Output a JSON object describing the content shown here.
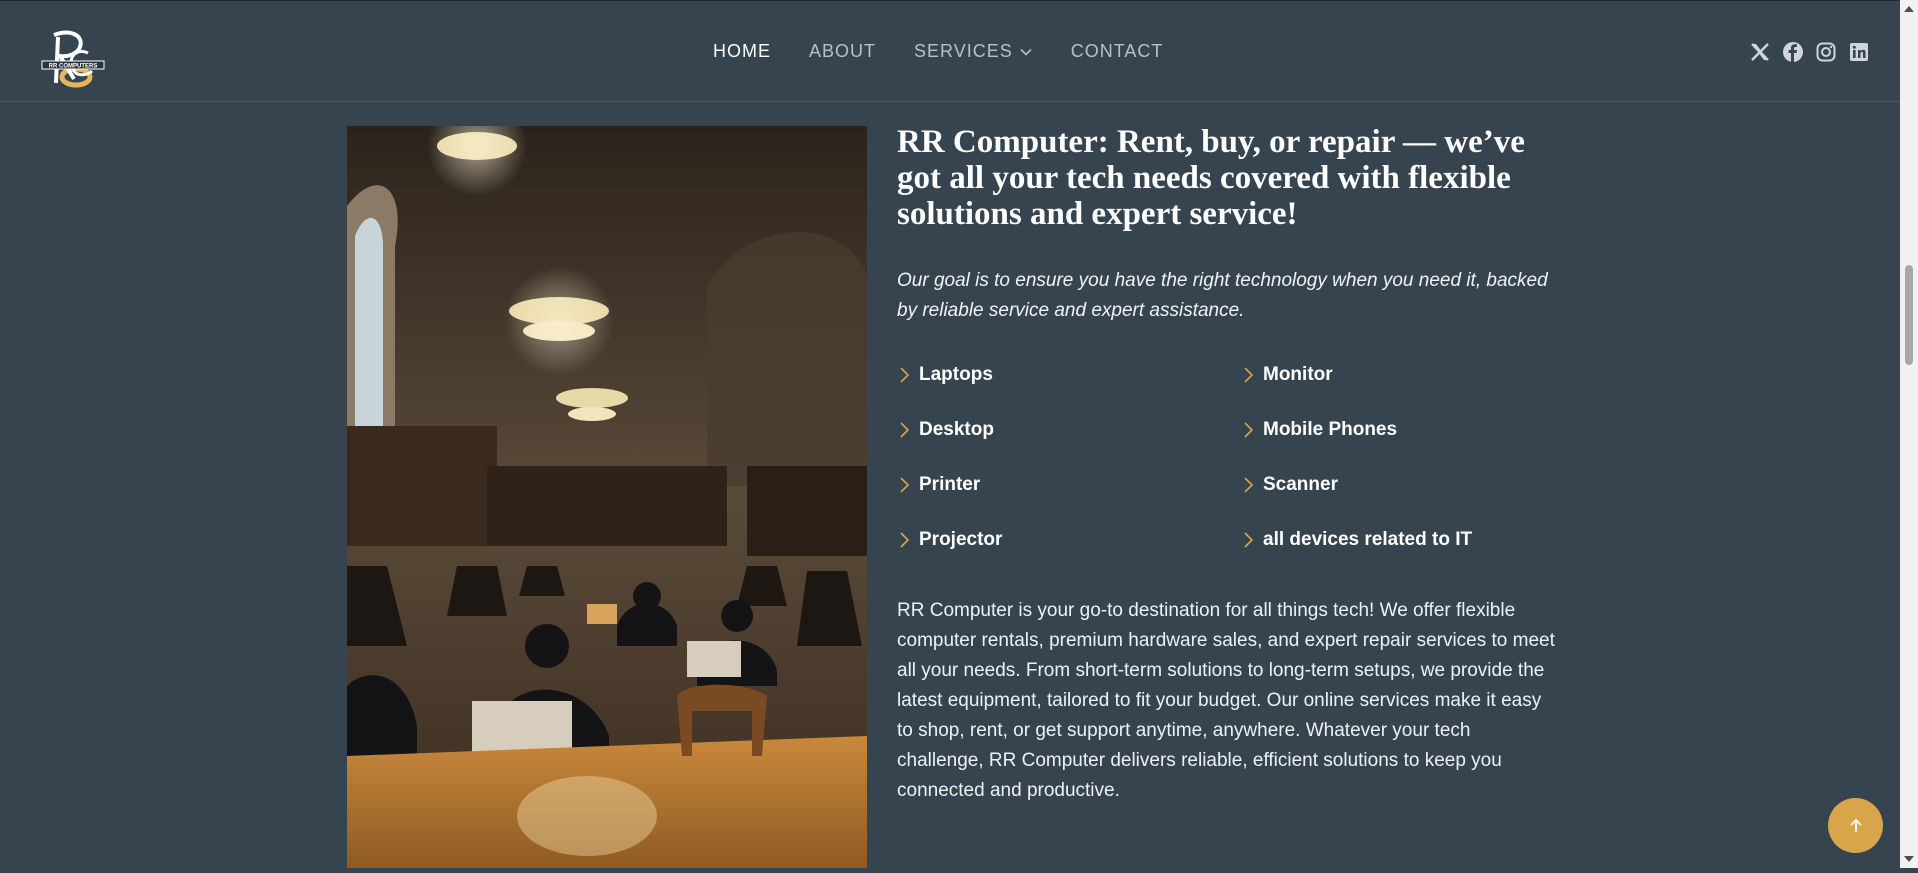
{
  "brand": {
    "logo_text": "RR COMPUTERS"
  },
  "nav": {
    "items": [
      {
        "label": "HOME",
        "active": true
      },
      {
        "label": "ABOUT",
        "active": false
      },
      {
        "label": "SERVICES",
        "active": false,
        "has_dropdown": true
      },
      {
        "label": "CONTACT",
        "active": false
      }
    ]
  },
  "social": [
    "x-icon",
    "facebook-icon",
    "instagram-icon",
    "linkedin-icon"
  ],
  "hero": {
    "heading": "RR Computer: Rent, buy, or repair — we’ve got all your tech needs covered with flexible solutions and expert service!",
    "lead": "Our goal is to ensure you have the right technology when you need it, backed by reliable service and expert assistance.",
    "features": [
      "Laptops",
      "Monitor",
      "Desktop",
      "Mobile Phones",
      "Printer",
      "Scanner",
      "Projector",
      "all devices related to IT"
    ],
    "description": "RR Computer is your go-to destination for all things tech! We offer flexible computer rentals, premium hardware sales, and expert repair services to meet all your needs. From short-term solutions to long-term setups, we provide the latest equipment, tailored to fit your budget. Our online services make it easy to shop, rent, or get support anytime, anywhere. Whatever your tech challenge, RR Computer delivers reliable, efficient solutions to keep you connected and productive."
  },
  "colors": {
    "background": "#36444f",
    "accent": "#d8a54a",
    "nav_active": "#ffffff",
    "nav_inactive": "#b8c0c7"
  }
}
